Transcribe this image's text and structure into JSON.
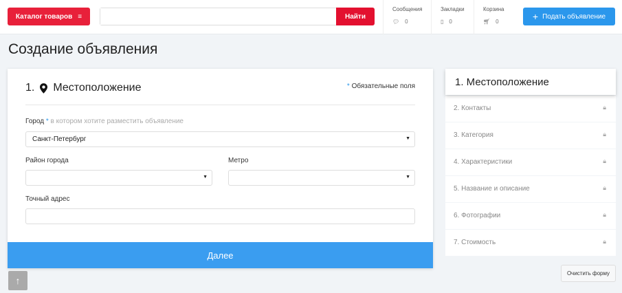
{
  "header": {
    "catalog": "Каталог товаров",
    "search_placeholder": "",
    "find": "Найти",
    "messages": {
      "label": "Сообщения",
      "count": "0"
    },
    "bookmarks": {
      "label": "Закладки",
      "count": "0"
    },
    "cart": {
      "label": "Корзина",
      "count": "0"
    },
    "post": "Подать объявление"
  },
  "page_title": "Создание объявления",
  "form": {
    "step_num": "1.",
    "title": "Местоположение",
    "required_star": "*",
    "required": "Обязательные поля",
    "city_label": "Город",
    "city_hint": "в котором хотите разместить объявление",
    "city_value": "Санкт-Петербург",
    "district_label": "Район города",
    "district_value": "",
    "metro_label": "Метро",
    "metro_value": "",
    "address_label": "Точный адрес",
    "address_value": "",
    "next": "Далее"
  },
  "steps": [
    "1. Местоположение",
    "2. Контакты",
    "3. Категория",
    "4. Характеристики",
    "5. Название и описание",
    "6. Фотографии",
    "7. Стоимость"
  ],
  "clear": "Очистить форму"
}
